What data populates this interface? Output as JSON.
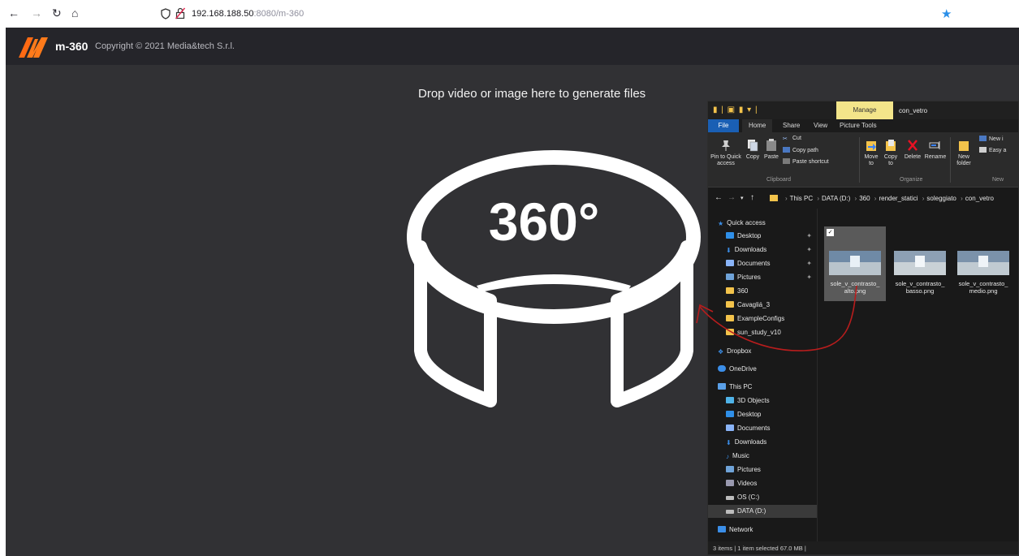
{
  "browser": {
    "url_host": "192.168.188.50",
    "url_path": ":8080/m-360"
  },
  "app": {
    "name": "m-360",
    "copyright": "Copyright © 2021 Media&tech S.r.l.",
    "drop_text": "Drop video or image here to generate files",
    "hero_text": "360°",
    "brand_color": "#ff6a13",
    "background": "#313134"
  },
  "explorer": {
    "manage_tab": "Manage",
    "title": "con_vetro",
    "tabs": [
      "File",
      "Home",
      "Share",
      "View",
      "Picture Tools"
    ],
    "ribbon": {
      "pin": "Pin to Quick access",
      "copy": "Copy",
      "paste": "Paste",
      "cut": "Cut",
      "copy_path": "Copy path",
      "paste_shortcut": "Paste shortcut",
      "clipboard": "Clipboard",
      "move_to": "Move to",
      "copy_to": "Copy to",
      "delete": "Delete",
      "rename": "Rename",
      "organize": "Organize",
      "new_folder": "New folder",
      "new_item": "New i",
      "easy_access": "Easy a",
      "new_group": "New"
    },
    "breadcrumb": [
      "This PC",
      "DATA (D:)",
      "360",
      "render_statici",
      "soleggiato",
      "con_vetro"
    ],
    "nav": {
      "quick_access": "Quick access",
      "desktop": "Desktop",
      "downloads": "Downloads",
      "documents": "Documents",
      "pictures": "Pictures",
      "f360": "360",
      "cavaglia": "Cavagliá_3",
      "example": "ExampleConfigs",
      "sun": "sun_study_v10",
      "dropbox": "Dropbox",
      "onedrive": "OneDrive",
      "thispc": "This PC",
      "objects3d": "3D Objects",
      "desktop2": "Desktop",
      "documents2": "Documents",
      "downloads2": "Downloads",
      "music": "Music",
      "pictures2": "Pictures",
      "videos": "Videos",
      "osc": "OS (C:)",
      "datad": "DATA (D:)",
      "network": "Network"
    },
    "files": [
      {
        "line1": "sole_v_contrasto_",
        "line2": "alto.png"
      },
      {
        "line1": "sole_v_contrasto_",
        "line2": "basso.png"
      },
      {
        "line1": "sole_v_contrasto_",
        "line2": "medio.png"
      }
    ],
    "status": "3 items  |  1 item selected  67.0 MB  |"
  }
}
